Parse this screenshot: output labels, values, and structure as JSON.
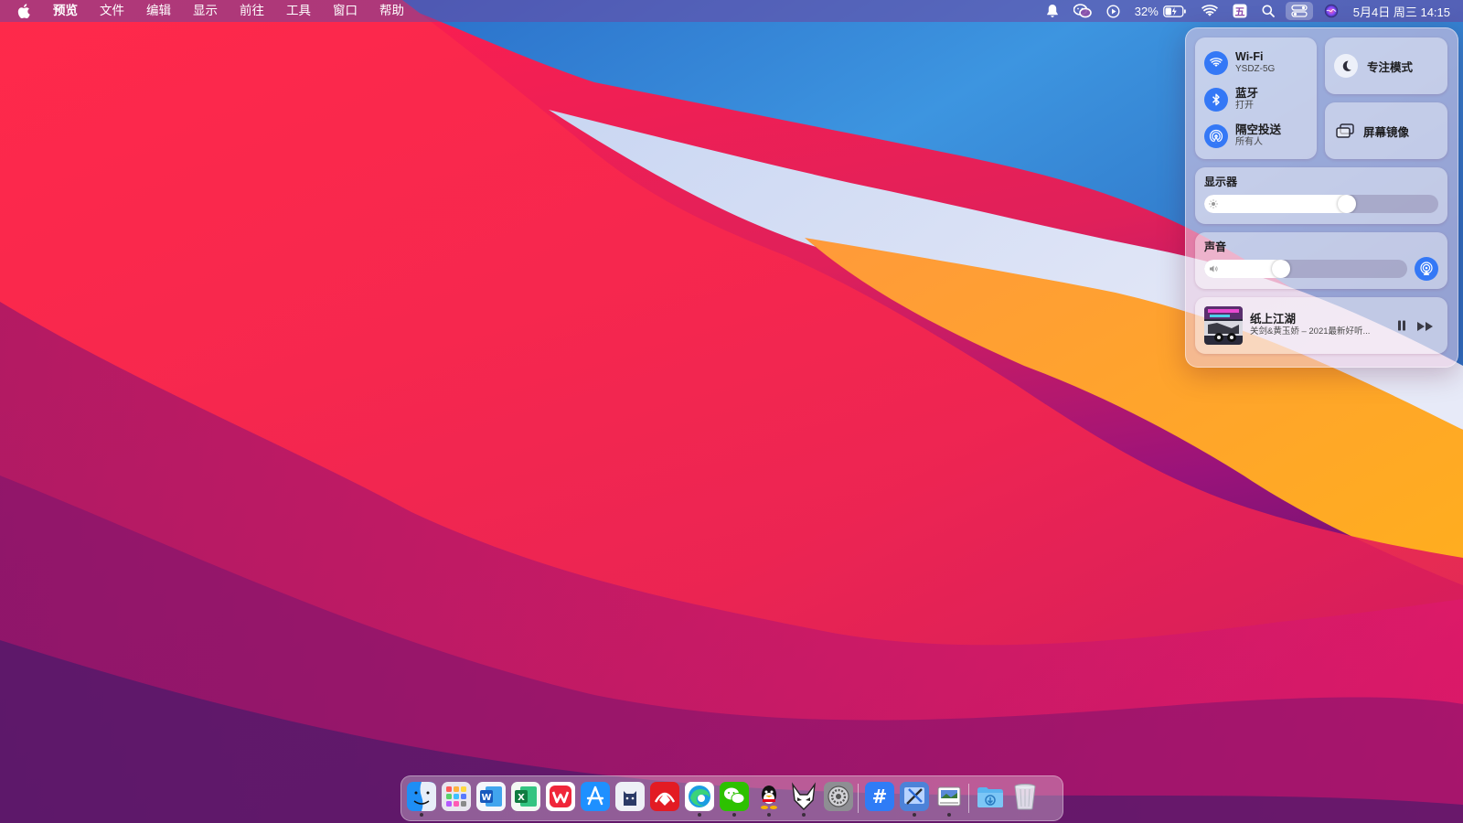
{
  "menubar": {
    "app_name": "预览",
    "menus": [
      "文件",
      "编辑",
      "显示",
      "前往",
      "工具",
      "窗口",
      "帮助"
    ],
    "battery_percent": "32%",
    "datetime": "5月4日 周三  14:15",
    "status_icons": [
      "notification-bell-icon",
      "wechat-icon",
      "play-circle-icon",
      "battery-charging-icon",
      "wifi-icon",
      "input-method-icon",
      "spotlight-search-icon",
      "control-center-icon",
      "siri-icon"
    ]
  },
  "control_center": {
    "wifi": {
      "title": "Wi-Fi",
      "subtitle": "YSDZ-5G"
    },
    "bluetooth": {
      "title": "蓝牙",
      "subtitle": "打开"
    },
    "airdrop": {
      "title": "隔空投送",
      "subtitle": "所有人"
    },
    "focus": {
      "label": "专注模式"
    },
    "screen_mirroring": {
      "label": "屏幕镜像"
    },
    "display": {
      "label": "显示器",
      "brightness": 0.61
    },
    "sound": {
      "label": "声音",
      "volume": 0.38
    },
    "now_playing": {
      "title": "纸上江湖",
      "artist": "关剑&黄玉娇 – 2021最新好听..."
    }
  },
  "dock": {
    "apps": [
      {
        "name": "finder",
        "running": true
      },
      {
        "name": "launchpad",
        "running": false
      },
      {
        "name": "word",
        "running": false
      },
      {
        "name": "excel",
        "running": false
      },
      {
        "name": "wps",
        "running": false
      },
      {
        "name": "app-store",
        "running": false
      },
      {
        "name": "cat-app",
        "running": false
      },
      {
        "name": "red-app",
        "running": false
      },
      {
        "name": "edge",
        "running": true
      },
      {
        "name": "wechat",
        "running": true
      },
      {
        "name": "qq",
        "running": true
      },
      {
        "name": "alien-app",
        "running": true
      },
      {
        "name": "system-preferences",
        "running": false
      },
      {
        "name": "hashtag-app",
        "running": false
      },
      {
        "name": "xcode-like",
        "running": true
      },
      {
        "name": "preview",
        "running": true
      },
      {
        "name": "downloads-folder",
        "running": false
      },
      {
        "name": "trash",
        "running": false
      }
    ]
  },
  "colors": {
    "accent_blue": "#3478f6",
    "wallpaper_red": "#f2274a",
    "wallpaper_orange": "#fca124",
    "wallpaper_blue": "#3a8fdc",
    "wallpaper_purple": "#8a1a8a"
  }
}
